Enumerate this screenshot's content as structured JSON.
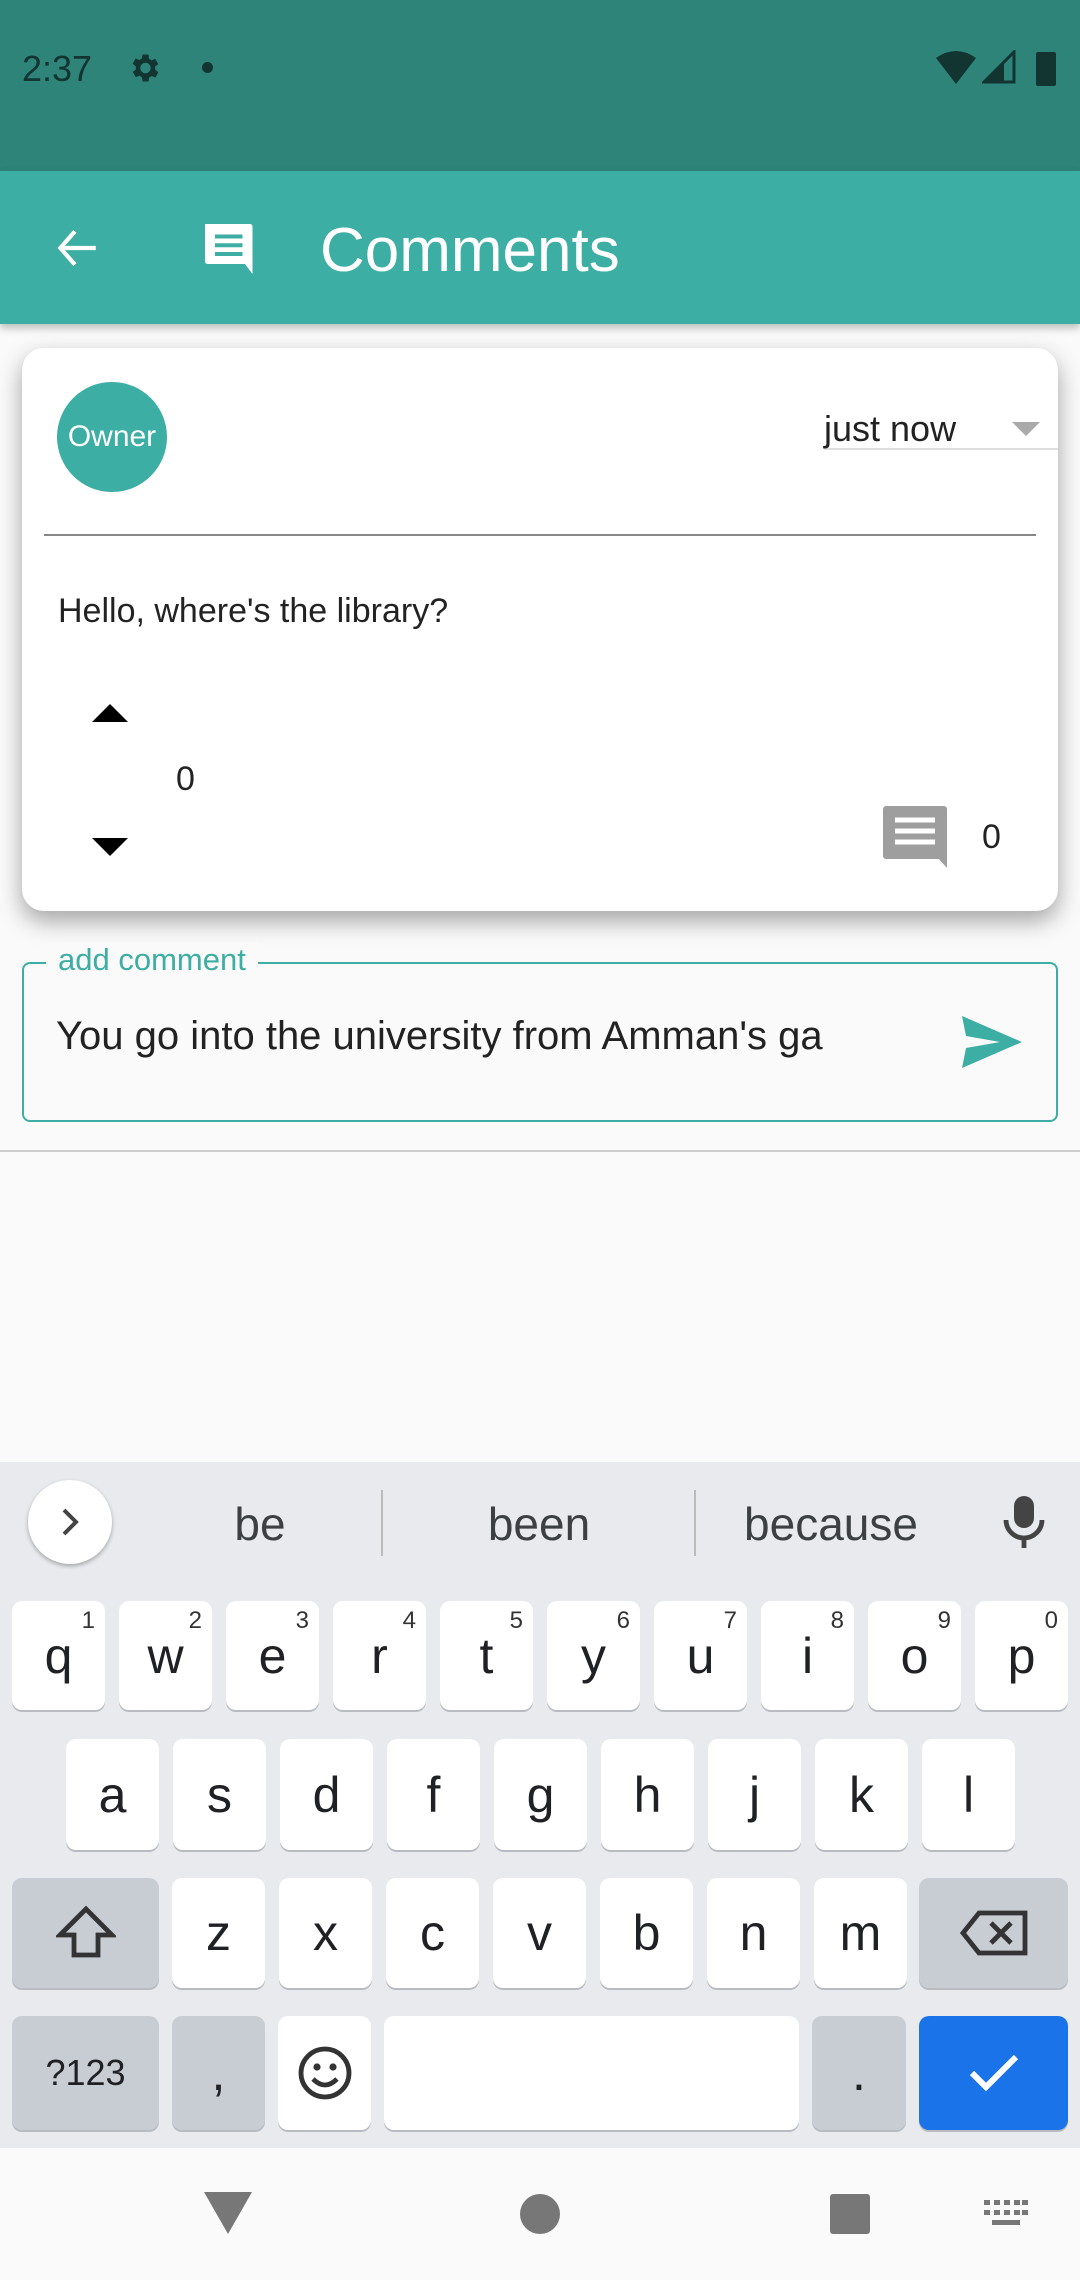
{
  "status_bar": {
    "time": "2:37",
    "icons": [
      "gear-icon",
      "dot-icon",
      "wifi-icon",
      "signal-icon",
      "battery-icon"
    ]
  },
  "app_bar": {
    "title": "Comments",
    "back_icon": "arrow-left-icon",
    "title_icon": "comment-icon"
  },
  "post": {
    "author_avatar": "Owner",
    "timestamp": "just now",
    "body": "Hello, where's the library?",
    "votes": "0",
    "comment_count": "0"
  },
  "comment_input": {
    "label": "add comment",
    "value": "You go into the university from Amman's ga",
    "send_icon": "send-icon"
  },
  "colors": {
    "primary": "#3daea3",
    "status_bar": "#2e8479",
    "keyboard_accent": "#1a73e8"
  },
  "keyboard": {
    "suggestions": [
      "be",
      "been",
      "because"
    ],
    "row1": [
      {
        "k": "q",
        "n": "1"
      },
      {
        "k": "w",
        "n": "2"
      },
      {
        "k": "e",
        "n": "3"
      },
      {
        "k": "r",
        "n": "4"
      },
      {
        "k": "t",
        "n": "5"
      },
      {
        "k": "y",
        "n": "6"
      },
      {
        "k": "u",
        "n": "7"
      },
      {
        "k": "i",
        "n": "8"
      },
      {
        "k": "o",
        "n": "9"
      },
      {
        "k": "p",
        "n": "0"
      }
    ],
    "row2": [
      "a",
      "s",
      "d",
      "f",
      "g",
      "h",
      "j",
      "k",
      "l"
    ],
    "row3": [
      "z",
      "x",
      "c",
      "v",
      "b",
      "n",
      "m"
    ],
    "symbols": "?123",
    "comma": ",",
    "period": "."
  }
}
